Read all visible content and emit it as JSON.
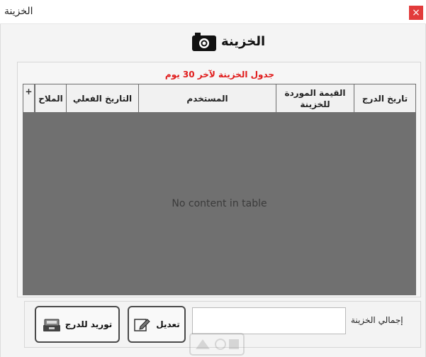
{
  "window": {
    "title": "الخزينة",
    "close_label": "×"
  },
  "header": {
    "title": "الخزينة",
    "icon": "camera-icon"
  },
  "table": {
    "caption": "جدول الخزينة لآخر 30 يوم",
    "columns": [
      "تاريخ الدرج",
      "القيمة الموردة للخزينة",
      "المستخدم",
      "التاريخ الفعلي",
      "الملاح"
    ],
    "expand_label": "+",
    "empty_message": "No content in table"
  },
  "bottom": {
    "total_label": "إجمالي الخزينة",
    "total_value": "",
    "edit_button": "تعديل",
    "supply_button": "توريد للدرج"
  },
  "colors": {
    "close_button": "#e23b3b",
    "caption": "#e01b1b",
    "table_body": "#707070"
  }
}
